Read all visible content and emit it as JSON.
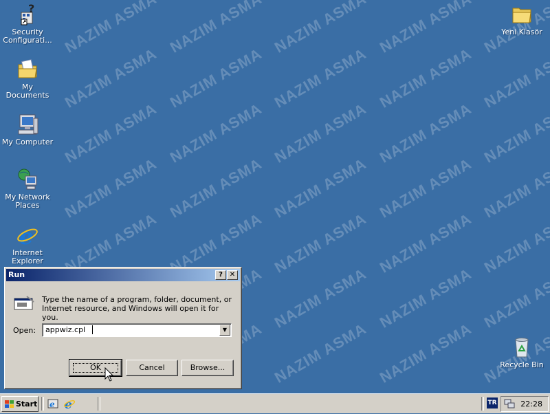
{
  "watermark": "NAZIM ASMA",
  "desktop": {
    "icons": [
      {
        "label": "Security Configurati...",
        "icon": "security-configuration-icon"
      },
      {
        "label": "My Documents",
        "icon": "my-documents-icon"
      },
      {
        "label": "My Computer",
        "icon": "my-computer-icon"
      },
      {
        "label": "My Network Places",
        "icon": "my-network-places-icon"
      },
      {
        "label": "Internet Explorer",
        "icon": "internet-explorer-icon"
      },
      {
        "label": "Yeni Klasör",
        "icon": "folder-icon"
      },
      {
        "label": "Recycle Bin",
        "icon": "recycle-bin-icon"
      }
    ]
  },
  "run_dialog": {
    "title": "Run",
    "help_button": "?",
    "close_button": "✕",
    "description": "Type the name of a program, folder, document, or Internet resource, and Windows will open it for you.",
    "open_label": "Open:",
    "open_value": "appwiz.cpl",
    "ok_label": "OK",
    "cancel_label": "Cancel",
    "browse_label": "Browse..."
  },
  "taskbar": {
    "start_label": "Start",
    "language": "TR",
    "clock": "22:28"
  },
  "colors": {
    "desktop": "#3a6ea5",
    "title_start": "#0a246a",
    "title_end": "#a6caf0",
    "chrome": "#d4d0c8"
  }
}
